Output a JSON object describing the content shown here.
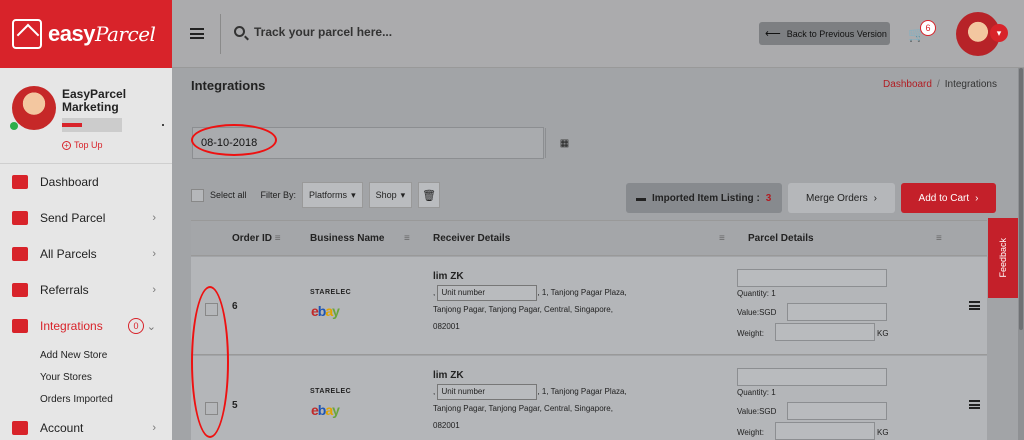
{
  "brand": {
    "name": "easy",
    "name2": "Parcel"
  },
  "profile": {
    "name": "EasyParcel Marketing",
    "topup": "Top Up"
  },
  "nav": [
    {
      "label": "Dashboard",
      "has_chevron": false
    },
    {
      "label": "Send Parcel",
      "has_chevron": true
    },
    {
      "label": "All Parcels",
      "has_chevron": true
    },
    {
      "label": "Referrals",
      "has_chevron": true
    },
    {
      "label": "Integrations",
      "has_chevron": true,
      "badge": "0"
    },
    {
      "label": "Account",
      "has_chevron": true
    }
  ],
  "subnav": [
    "Add New Store",
    "Your Stores",
    "Orders Imported"
  ],
  "topbar": {
    "search_placeholder": "Track your parcel here...",
    "back_label": "Back to Previous Version",
    "cart_count": "6"
  },
  "page": {
    "title": "Integrations",
    "breadcrumb": {
      "home": "Dashboard",
      "current": "Integrations"
    },
    "date_value": "08-10-2018",
    "select_all": "Select all",
    "filter_by": "Filter By:",
    "filter_platforms": "Platforms",
    "filter_shop": "Shop",
    "imported_label": "Imported Item Listing :",
    "imported_count": "3",
    "merge_label": "Merge Orders",
    "add_label": "Add to Cart",
    "feedback": "Feedback"
  },
  "table": {
    "headers": [
      "Order ID",
      "Business Name",
      "Receiver Details",
      "Parcel Details"
    ],
    "unit_placeholder": "Unit number",
    "quantity_label": "Quantity: 1",
    "value_label": "Value:SGD",
    "weight_label": "Weight:",
    "weight_unit": "KG",
    "rows": [
      {
        "order_id": "6",
        "shop": "STARELEC",
        "platform": "ebay",
        "receiver": "lim ZK",
        "addr_prefix": ",",
        "addr_rest": ", 1, Tanjong Pagar Plaza, Tanjong Pagar, Tanjong Pagar, Central, Singapore, 082001"
      },
      {
        "order_id": "5",
        "shop": "STARELEC",
        "platform": "ebay",
        "receiver": "lim ZK",
        "addr_prefix": ",",
        "addr_rest": ", 1, Tanjong Pagar Plaza, Tanjong Pagar, Tanjong Pagar, Central, Singapore, 082001"
      }
    ]
  },
  "colors": {
    "brand_red": "#d8232a"
  }
}
